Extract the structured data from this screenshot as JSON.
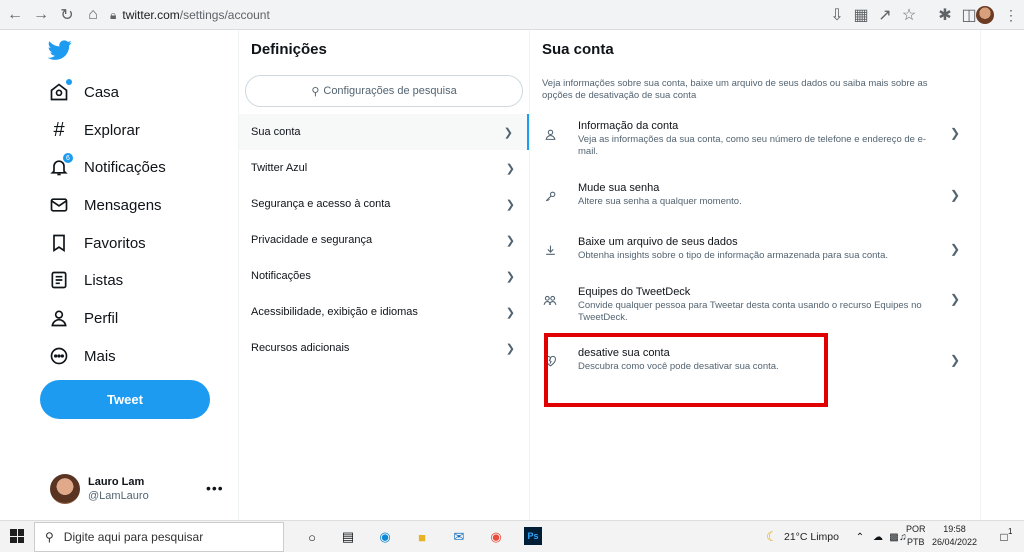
{
  "browser": {
    "url_host": "twitter.com",
    "url_path": "/settings/account"
  },
  "nav": {
    "items": [
      {
        "label": "Casa",
        "icon": "home-icon"
      },
      {
        "label": "Explorar",
        "icon": "hashtag-icon"
      },
      {
        "label": "Notificações",
        "icon": "bell-icon",
        "badge": "6"
      },
      {
        "label": "Mensagens",
        "icon": "mail-icon"
      },
      {
        "label": "Favoritos",
        "icon": "bookmark-icon"
      },
      {
        "label": "Listas",
        "icon": "list-icon"
      },
      {
        "label": "Perfil",
        "icon": "person-icon"
      },
      {
        "label": "Mais",
        "icon": "more-circle-icon"
      }
    ],
    "tweet_label": "Tweet",
    "user": {
      "name": "Lauro Lam",
      "handle": "@LamLauro",
      "more": "•••"
    }
  },
  "settings": {
    "title": "Definições",
    "search_placeholder": "Configurações de pesquisa",
    "items": [
      "Sua conta",
      "Twitter Azul",
      "Segurança e acesso à conta",
      "Privacidade e segurança",
      "Notificações",
      "Acessibilidade, exibição e idiomas",
      "Recursos adicionais"
    ]
  },
  "account": {
    "title": "Sua conta",
    "description": "Veja informações sobre sua conta, baixe um arquivo de seus dados ou saiba mais sobre as opções de desativação de sua conta",
    "items": [
      {
        "title": "Informação da conta",
        "sub": "Veja as informações da sua conta, como seu número de telefone e endereço de e-mail.",
        "icon": "person-icon"
      },
      {
        "title": "Mude sua senha",
        "sub": "Altere sua senha a qualquer momento.",
        "icon": "key-icon"
      },
      {
        "title": "Baixe um arquivo de seus dados",
        "sub": "Obtenha insights sobre o tipo de informação armazenada para sua conta.",
        "icon": "download-icon"
      },
      {
        "title": "Equipes do TweetDeck",
        "sub": "Convide qualquer pessoa para Tweetar desta conta usando o recurso Equipes no TweetDeck.",
        "icon": "people-icon"
      },
      {
        "title": "desative sua conta",
        "sub": "Descubra como você pode desativar sua conta.",
        "icon": "broken-heart-icon"
      }
    ]
  },
  "taskbar": {
    "search_placeholder": "Digite aqui para pesquisar",
    "weather": "21°C  Limpo",
    "lang_top": "POR",
    "lang_bottom": "PTB",
    "time": "19:58",
    "date": "26/04/2022",
    "notif_count": "1"
  },
  "colors": {
    "accent": "#1d9bf0",
    "highlight": "#e00000"
  }
}
